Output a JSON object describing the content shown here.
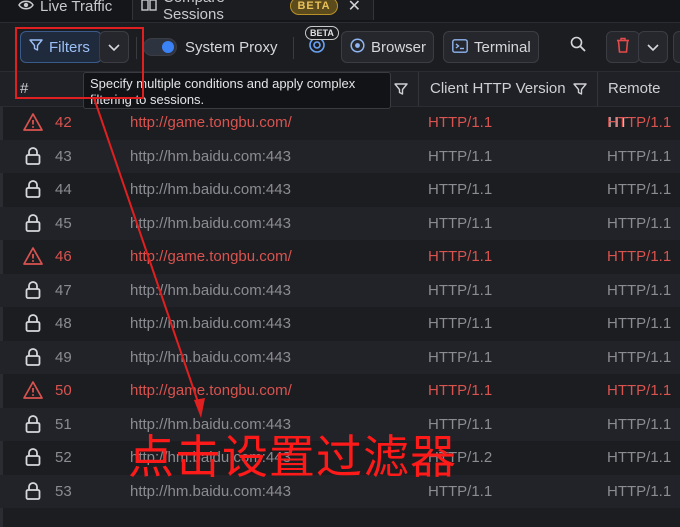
{
  "tabs": [
    {
      "label": "Live Traffic",
      "icon": "eye-icon"
    },
    {
      "label": "Compare Sessions",
      "icon": "compare-icon",
      "badge": "BETA"
    }
  ],
  "toolbar": {
    "filters_label": "Filters",
    "system_proxy_label": "System Proxy",
    "system_proxy_on": true,
    "beta_tag": "BETA",
    "browser_label": "Browser",
    "terminal_label": "Terminal"
  },
  "tooltip": {
    "text_line1": "Specify multiple conditions and apply complex",
    "text_line2": "filtering to sessions."
  },
  "table": {
    "headers": {
      "num": "#",
      "client_version": "Client HTTP Version",
      "remote_version": "Remote HT"
    },
    "rows": [
      {
        "num": "42",
        "host": "http://game.tongbu.com/",
        "client": "HTTP/1.1",
        "remote": "HTTP/1.1",
        "status": "warn"
      },
      {
        "num": "43",
        "host": "http://hm.baidu.com:443",
        "client": "HTTP/1.1",
        "remote": "HTTP/1.1",
        "status": "lock"
      },
      {
        "num": "44",
        "host": "http://hm.baidu.com:443",
        "client": "HTTP/1.1",
        "remote": "HTTP/1.1",
        "status": "lock"
      },
      {
        "num": "45",
        "host": "http://hm.baidu.com:443",
        "client": "HTTP/1.1",
        "remote": "HTTP/1.1",
        "status": "lock"
      },
      {
        "num": "46",
        "host": "http://game.tongbu.com/",
        "client": "HTTP/1.1",
        "remote": "HTTP/1.1",
        "status": "warn"
      },
      {
        "num": "47",
        "host": "http://hm.baidu.com:443",
        "client": "HTTP/1.1",
        "remote": "HTTP/1.1",
        "status": "lock"
      },
      {
        "num": "48",
        "host": "http://hm.baidu.com:443",
        "client": "HTTP/1.1",
        "remote": "HTTP/1.1",
        "status": "lock"
      },
      {
        "num": "49",
        "host": "http://hm.baidu.com:443",
        "client": "HTTP/1.1",
        "remote": "HTTP/1.1",
        "status": "lock"
      },
      {
        "num": "50",
        "host": "http://game.tongbu.com/",
        "client": "HTTP/1.1",
        "remote": "HTTP/1.1",
        "status": "warn"
      },
      {
        "num": "51",
        "host": "http://hm.baidu.com:443",
        "client": "HTTP/1.1",
        "remote": "HTTP/1.1",
        "status": "lock"
      },
      {
        "num": "52",
        "host": "http://hm.baidu.com:443",
        "client": "HTTP/1.2",
        "remote": "HTTP/1.1",
        "status": "lock"
      },
      {
        "num": "53",
        "host": "http://hm.baidu.com:443",
        "client": "HTTP/1.1",
        "remote": "HTTP/1.1",
        "status": "lock"
      }
    ]
  },
  "annotation": {
    "caption": "点击设置过滤器",
    "color": "#ff1a1a"
  },
  "colors": {
    "warn": "#d9534f",
    "ok": "#8b8c92",
    "accent": "#3b82f6"
  }
}
